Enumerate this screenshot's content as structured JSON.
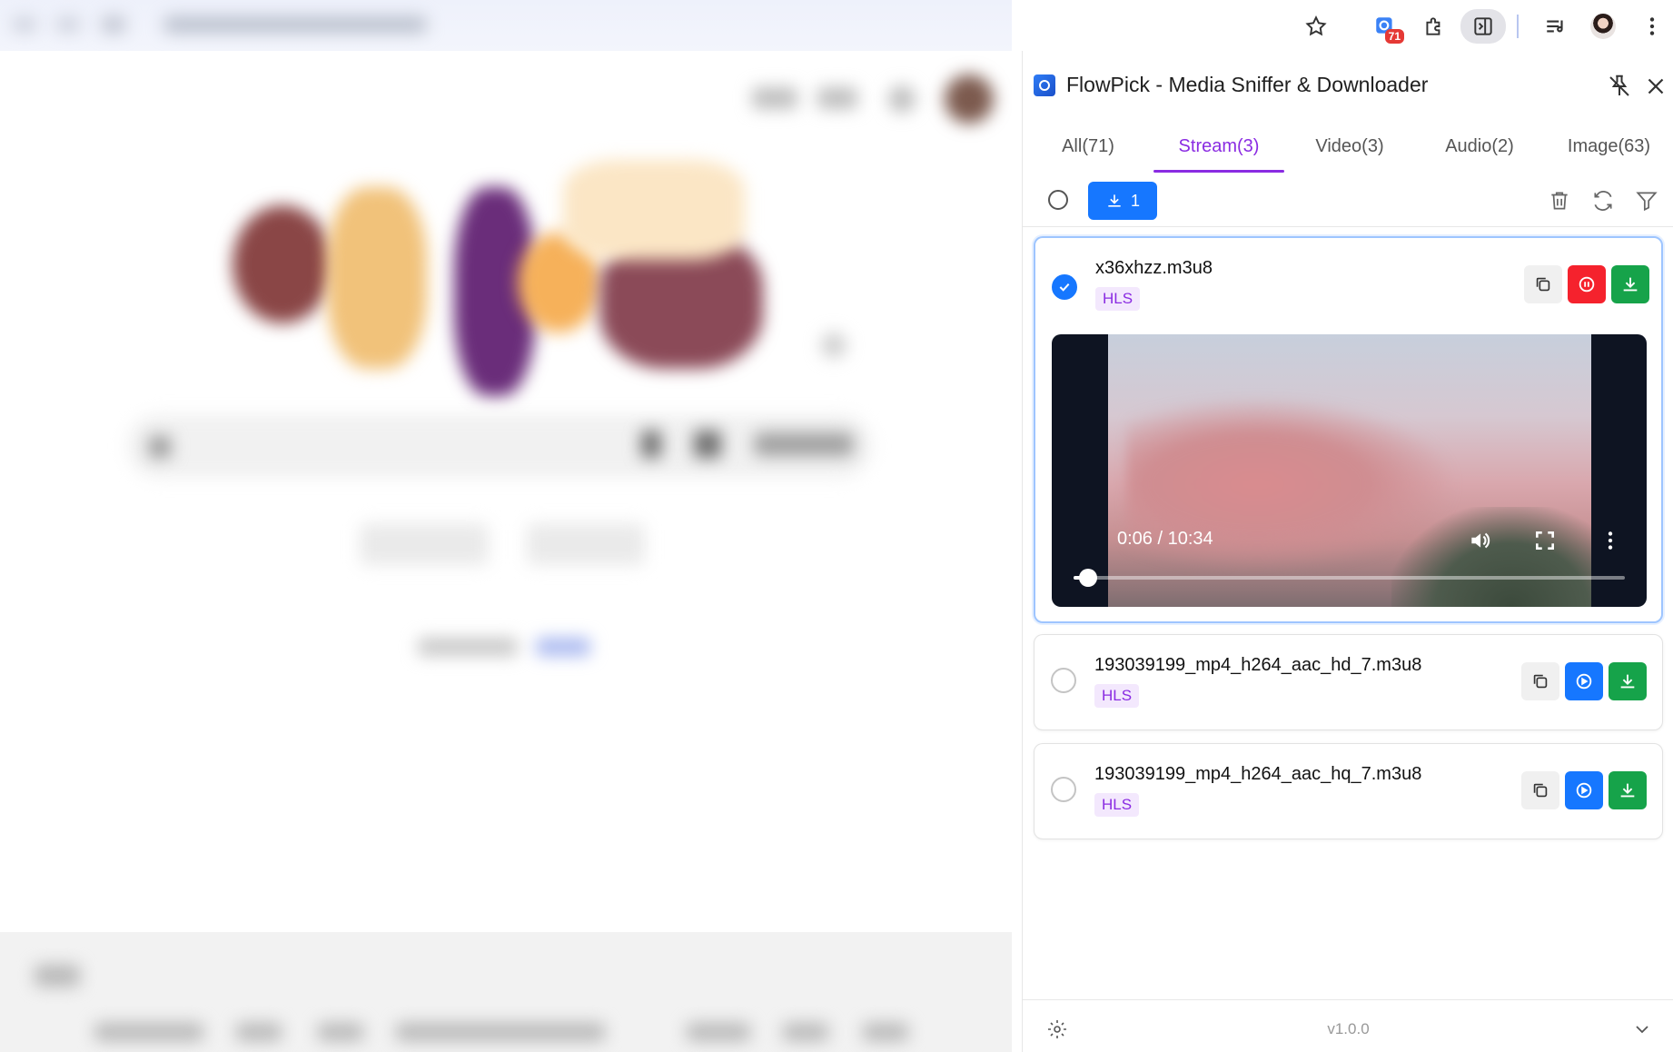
{
  "colors": {
    "accent": "#8a2be2",
    "primary": "#1677ff",
    "danger": "#f5222d",
    "success": "#16a34a",
    "tag_bg": "#f3e8fd"
  },
  "toolbar": {
    "extension_badge": "71",
    "icons": [
      "star-icon",
      "extension-flowpick-icon",
      "puzzle-icon",
      "side-panel-icon",
      "media-queue-icon",
      "profile-avatar",
      "more-vert-icon"
    ]
  },
  "panel": {
    "title": "FlowPick - Media Sniffer & Downloader",
    "tabs": [
      {
        "label": "All(71)",
        "active": false
      },
      {
        "label": "Stream(3)",
        "active": true
      },
      {
        "label": "Video(3)",
        "active": false
      },
      {
        "label": "Audio(2)",
        "active": false
      },
      {
        "label": "Image(63)",
        "active": false
      }
    ],
    "download_selected_count": "1",
    "items": [
      {
        "name": "x36xhzz.m3u8",
        "tag": "HLS",
        "selected": true,
        "playing": true
      },
      {
        "name": "193039199_mp4_h264_aac_hd_7.m3u8",
        "tag": "HLS",
        "selected": false,
        "playing": false
      },
      {
        "name": "193039199_mp4_h264_aac_hq_7.m3u8",
        "tag": "HLS",
        "selected": false,
        "playing": false
      }
    ],
    "player": {
      "time": "0:06 / 10:34",
      "progress_fraction": 0.0096
    },
    "version": "v1.0.0"
  }
}
